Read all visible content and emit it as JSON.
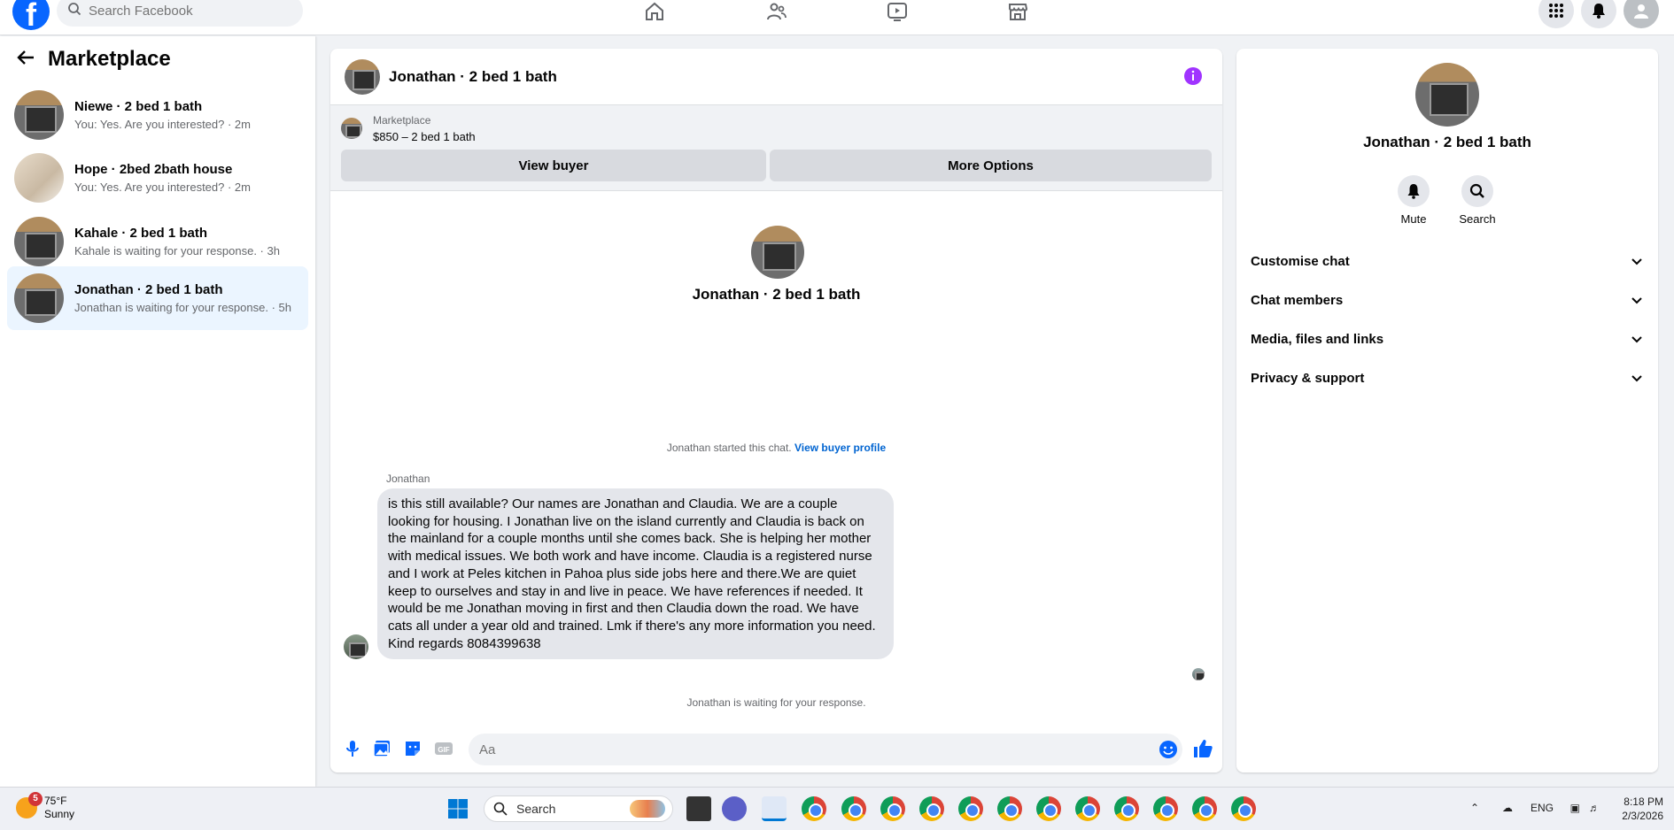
{
  "topbar": {
    "search_placeholder": "Search Facebook",
    "logo_letter": "f"
  },
  "sidebar": {
    "title": "Marketplace",
    "conversations": [
      {
        "name": "Niewe · 2 bed 1 bath",
        "preview": "You: Yes. Are you interested? · 2m",
        "thumb": "stove"
      },
      {
        "name": "Hope · 2bed 2bath house",
        "preview": "You: Yes. Are you interested? · 2m",
        "thumb": "house"
      },
      {
        "name": "Kahale · 2 bed 1 bath",
        "preview": "Kahale is waiting for your response. · 3h",
        "thumb": "stove"
      },
      {
        "name": "Jonathan · 2 bed 1 bath",
        "preview": "Jonathan is waiting for your response. · 5h",
        "thumb": "stove",
        "active": true
      }
    ]
  },
  "chat": {
    "title": "Jonathan · 2 bed 1 bath",
    "marketplace_label": "Marketplace",
    "listing": "$850 – 2 bed 1 bath",
    "view_buyer_label": "View buyer",
    "more_options_label": "More Options",
    "center_name": "Jonathan · 2 bed 1 bath",
    "started_text": "Jonathan started this chat.",
    "view_profile_link": "View buyer profile",
    "sender": "Jonathan",
    "message": "is this still available? Our names are Jonathan and Claudia. We are a couple looking for housing. I Jonathan live on the island currently and Claudia is back on the mainland for a couple months until she comes back. She is helping her mother with medical issues. We both work and have income. Claudia is a registered nurse and I work at Peles kitchen in Pahoa plus side jobs here and there.We are quiet keep to ourselves and stay in and live in peace. We have references if needed. It would be me Jonathan moving in first and then Claudia down the road. We have cats all under a year old and trained. Lmk if there's any more information you need. Kind regards 8084399638",
    "waiting_text": "Jonathan is waiting for your response.",
    "composer_placeholder": "Aa"
  },
  "right_panel": {
    "name": "Jonathan · 2 bed 1 bath",
    "mute_label": "Mute",
    "search_label": "Search",
    "sections": [
      "Customise chat",
      "Chat members",
      "Media, files and links",
      "Privacy & support"
    ]
  },
  "taskbar": {
    "weather_temp": "75°F",
    "weather_desc": "Sunny",
    "weather_badge": "5",
    "search_label": "Search",
    "language": "ENG",
    "time": "8:18 PM",
    "date": "2/3/2026"
  },
  "colors": {
    "brand": "#0866ff",
    "accent_purple": "#a033ff",
    "link": "#0064d1",
    "active_row": "#ebf5ff"
  }
}
